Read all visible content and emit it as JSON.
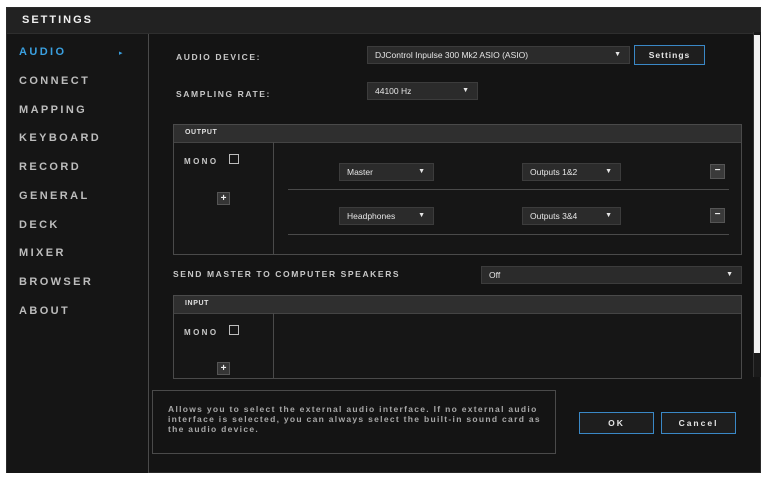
{
  "window": {
    "title": "SETTINGS"
  },
  "sidebar": {
    "items": [
      {
        "label": "AUDIO",
        "active": true
      },
      {
        "label": "CONNECT"
      },
      {
        "label": "MAPPING"
      },
      {
        "label": "KEYBOARD"
      },
      {
        "label": "RECORD"
      },
      {
        "label": "GENERAL"
      },
      {
        "label": "DECK"
      },
      {
        "label": "MIXER"
      },
      {
        "label": "BROWSER"
      },
      {
        "label": "ABOUT"
      }
    ]
  },
  "audio_device": {
    "label": "AUDIO DEVICE:",
    "value": "DJControl Inpulse 300 Mk2 ASIO (ASIO)",
    "settings_label": "Settings"
  },
  "sampling_rate": {
    "label": "SAMPLING RATE:",
    "value": "44100 Hz"
  },
  "output": {
    "title": "OUTPUT",
    "mono_label": "MONO",
    "add_label": "+",
    "remove_label": "−",
    "rows": [
      {
        "source": "Master",
        "destination": "Outputs 1&2"
      },
      {
        "source": "Headphones",
        "destination": "Outputs 3&4"
      }
    ]
  },
  "speakers": {
    "label": "SEND MASTER TO COMPUTER SPEAKERS",
    "value": "Off"
  },
  "input": {
    "title": "INPUT",
    "mono_label": "MONO",
    "add_label": "+"
  },
  "help_text": "Allows you to select the external audio interface. If no external audio interface is selected, you can always select the built-in sound card as the audio device.",
  "footer": {
    "ok_label": "OK",
    "cancel_label": "Cancel"
  },
  "colors": {
    "accent": "#3aa0e0",
    "background": "#141414",
    "button_border": "#3a88c6"
  },
  "icons": {
    "dropdown": "caret-down-icon",
    "active_nav": "chevron-right-icon"
  }
}
